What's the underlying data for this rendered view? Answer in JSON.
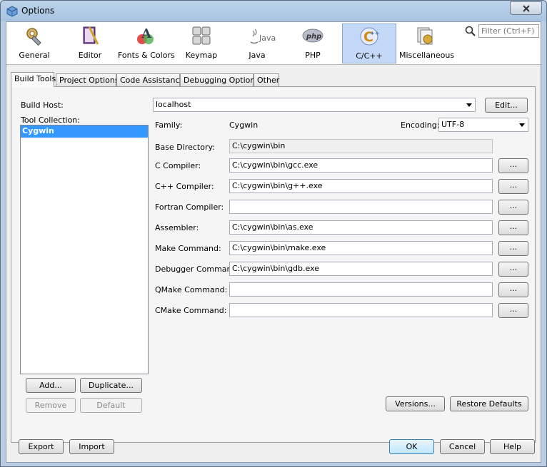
{
  "window": {
    "title": "Options"
  },
  "toolbar": {
    "categories": [
      {
        "label": "General",
        "icon": "gear-wrench-icon"
      },
      {
        "label": "Editor",
        "icon": "book-pen-icon"
      },
      {
        "label": "Fonts & Colors",
        "icon": "fonts-colors-icon"
      },
      {
        "label": "Keymap",
        "icon": "keyboard-icon"
      },
      {
        "label": "Java",
        "icon": "java-icon"
      },
      {
        "label": "PHP",
        "icon": "php-icon"
      },
      {
        "label": "C/C++",
        "icon": "cpp-icon",
        "selected": true
      },
      {
        "label": "Miscellaneous",
        "icon": "misc-icon"
      }
    ],
    "filter_placeholder": "Filter (Ctrl+F)"
  },
  "tabs": [
    "Build Tools",
    "Project Options",
    "Code Assistance",
    "Debugging Options",
    "Other"
  ],
  "build_tools": {
    "build_host_label": "Build Host:",
    "build_host_value": "localhost",
    "edit_label": "Edit...",
    "tool_collection_label": "Tool Collection:",
    "tool_collections": [
      "Cygwin"
    ],
    "family_label": "Family:",
    "family_value": "Cygwin",
    "encoding_label": "Encoding:",
    "encoding_value": "UTF-8",
    "fields": [
      {
        "label": "Base Directory:",
        "value": "C:\\cygwin\\bin",
        "readonly": true
      },
      {
        "label": "C Compiler:",
        "value": "C:\\cygwin\\bin\\gcc.exe"
      },
      {
        "label": "C++ Compiler:",
        "value": "C:\\cygwin\\bin\\g++.exe"
      },
      {
        "label": "Fortran Compiler:",
        "value": ""
      },
      {
        "label": "Assembler:",
        "value": "C:\\cygwin\\bin\\as.exe"
      },
      {
        "label": "Make Command:",
        "value": "C:\\cygwin\\bin\\make.exe"
      },
      {
        "label": "Debugger Command:",
        "value": "C:\\cygwin\\bin\\gdb.exe"
      },
      {
        "label": "QMake Command:",
        "value": ""
      },
      {
        "label": "CMake Command:",
        "value": ""
      }
    ],
    "browse_label": "...",
    "add_label": "Add...",
    "duplicate_label": "Duplicate...",
    "remove_label": "Remove",
    "default_label": "Default",
    "versions_label": "Versions...",
    "restore_label": "Restore Defaults"
  },
  "footer": {
    "export_label": "Export",
    "import_label": "Import",
    "ok_label": "OK",
    "cancel_label": "Cancel",
    "help_label": "Help"
  }
}
